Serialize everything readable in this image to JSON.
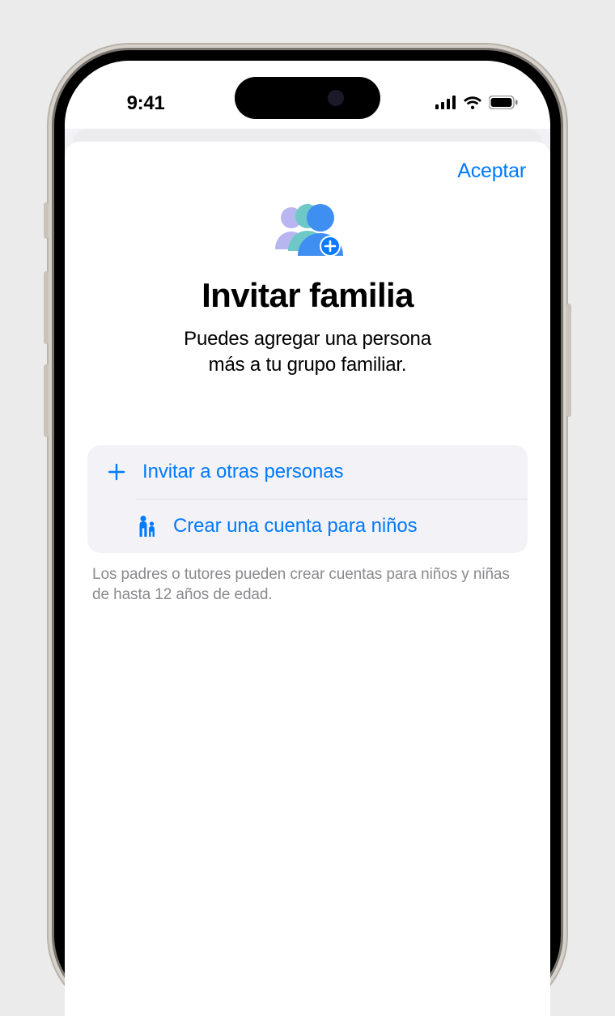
{
  "status": {
    "time": "9:41"
  },
  "sheet": {
    "done": "Aceptar",
    "title": "Invitar familia",
    "subtitle_line1": "Puedes agregar una persona",
    "subtitle_line2": "más a tu grupo familiar."
  },
  "list": {
    "invite": "Invitar a otras personas",
    "create_child": "Crear una cuenta para niños"
  },
  "footnote": "Los padres o tutores pueden crear cuentas para niños y niñas de hasta 12 años de edad."
}
